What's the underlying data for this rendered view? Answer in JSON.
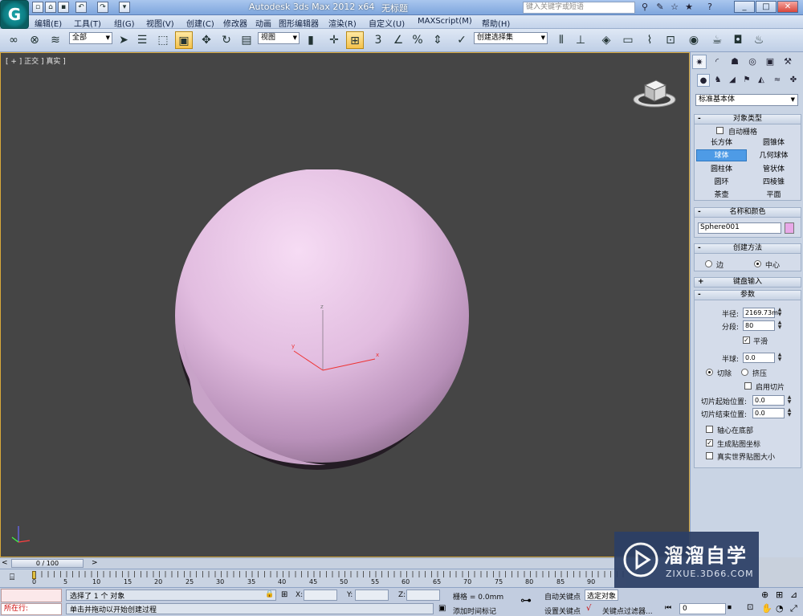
{
  "titlebar": {
    "app_title": "Autodesk 3ds Max  2012 x64",
    "doc_name": "无标题",
    "search_placeholder": "键入关键字或短语",
    "app_icon_glyph": "G"
  },
  "menu": [
    "编辑(E)",
    "工具(T)",
    "组(G)",
    "视图(V)",
    "创建(C)",
    "修改器",
    "动画",
    "图形编辑器",
    "渲染(R)",
    "自定义(U)",
    "MAXScript(M)",
    "帮助(H)"
  ],
  "toolbar": {
    "selection_filter": "全部",
    "ref_coord": "视图",
    "named_selection": "创建选择集",
    "snap_label": "3",
    "angle_snap_label": "%"
  },
  "viewport": {
    "label": "[ + ] 正交 ] 真实 ]",
    "sphere_color": "#e0b8e0",
    "bg_color": "#454545",
    "axis_x": "x",
    "axis_y": "y",
    "axis_z": "z"
  },
  "panel": {
    "category": "标准基本体",
    "object_type": {
      "title": "对象类型",
      "autogrid": "自动栅格",
      "buttons": [
        "长方体",
        "圆锥体",
        "球体",
        "几何球体",
        "圆柱体",
        "管状体",
        "圆环",
        "四棱锥",
        "茶壶",
        "平面"
      ],
      "selected": "球体"
    },
    "name_color": {
      "title": "名称和颜色",
      "name": "Sphere001",
      "swatch": "#e8a8e8"
    },
    "creation_method": {
      "title": "创建方法",
      "edge": "边",
      "center": "中心",
      "selected": "中心"
    },
    "keyboard_entry": {
      "title": "键盘输入"
    },
    "params": {
      "title": "参数",
      "radius_label": "半径:",
      "radius": "2169.73m",
      "segments_label": "分段:",
      "segments": "80",
      "smooth_label": "平滑",
      "smooth": true,
      "hemisphere_label": "半球:",
      "hemisphere": "0.0",
      "chop": "切除",
      "squash": "挤压",
      "slice_on": "启用切片",
      "slice_from_label": "切片起始位置:",
      "slice_from": "0.0",
      "slice_to_label": "切片结束位置:",
      "slice_to": "0.0",
      "base_to_pivot": "轴心在底部",
      "gen_mapping": "生成贴图坐标",
      "real_world": "真实世界贴图大小"
    }
  },
  "timeline": {
    "frame": "0 / 100",
    "ticks": [
      "0",
      "5",
      "10",
      "15",
      "20",
      "25",
      "30",
      "35",
      "40",
      "45",
      "50",
      "55",
      "60",
      "65",
      "70",
      "75",
      "80",
      "85",
      "90"
    ]
  },
  "status": {
    "maxscript": "所在行:",
    "selected_text": "选择了 1 个 对象",
    "prompt_text": "单击并拖动以开始创建过程",
    "x_label": "X:",
    "y_label": "Y:",
    "z_label": "Z:",
    "grid_label": "栅格 = 0.0mm",
    "autokey": "自动关键点",
    "selected_obj": "选定对象",
    "setkey": "设置关键点",
    "key_filters": "关键点过滤器...",
    "add_time_tag": "添加时间标记",
    "frame_field": "0"
  },
  "watermark": {
    "title": "溜溜自学",
    "url": "ZIXUE.3D66.COM"
  }
}
